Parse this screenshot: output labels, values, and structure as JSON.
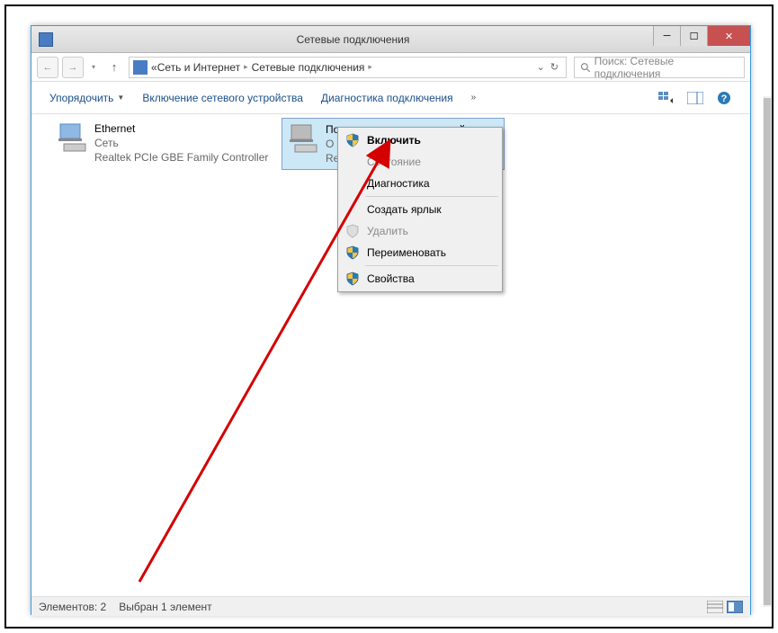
{
  "titlebar": {
    "title": "Сетевые подключения"
  },
  "breadcrumb": {
    "prefix": "«",
    "items": [
      "Сеть и Интернет",
      "Сетевые подключения"
    ]
  },
  "search": {
    "placeholder": "Поиск: Сетевые подключения"
  },
  "toolbar": {
    "organize": "Упорядочить",
    "enable_device": "Включение сетевого устройства",
    "diagnostics": "Диагностика подключения",
    "overflow": "»"
  },
  "connections": [
    {
      "title": "Ethernet",
      "line2": "Сеть",
      "line3": "Realtek PCIe GBE Family Controller"
    },
    {
      "title": "Подключение по локальной сети",
      "line2": "О",
      "line3": "Re"
    }
  ],
  "context_menu": {
    "enable": "Включить",
    "status": "Состояние",
    "diagnose": "Диагностика",
    "shortcut": "Создать ярлык",
    "delete": "Удалить",
    "rename": "Переименовать",
    "properties": "Свойства"
  },
  "statusbar": {
    "items_count": "Элементов: 2",
    "selected": "Выбран 1 элемент"
  }
}
